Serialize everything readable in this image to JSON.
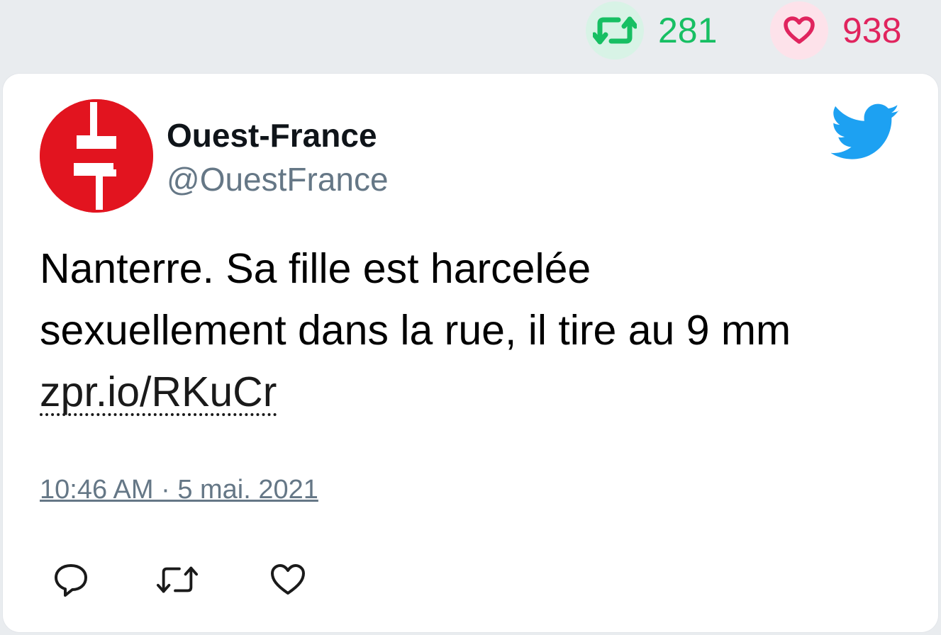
{
  "stats": {
    "retweets": "281",
    "likes": "938",
    "retweet_icon": "retweet-icon",
    "like_icon": "heart-icon"
  },
  "author": {
    "name": "Ouest-France",
    "handle": "@OuestFrance",
    "avatar_icon": "ouest-france-logo"
  },
  "tweet": {
    "text_line_1": "Nanterre. Sa fille est harcelée",
    "text_line_2": "sexuellement dans la rue, il tire au 9 mm",
    "link": "zpr.io/RKuCr",
    "timestamp": "10:46 AM · 5 mai. 2021"
  },
  "actions": {
    "reply_icon": "reply-icon",
    "retweet_icon": "retweet-icon",
    "like_icon": "heart-icon"
  },
  "colors": {
    "retweet_green": "#17bf63",
    "like_red": "#e0245e",
    "twitter_blue": "#1da1f2",
    "logo_red": "#e2141f",
    "handle_gray": "#657786"
  }
}
